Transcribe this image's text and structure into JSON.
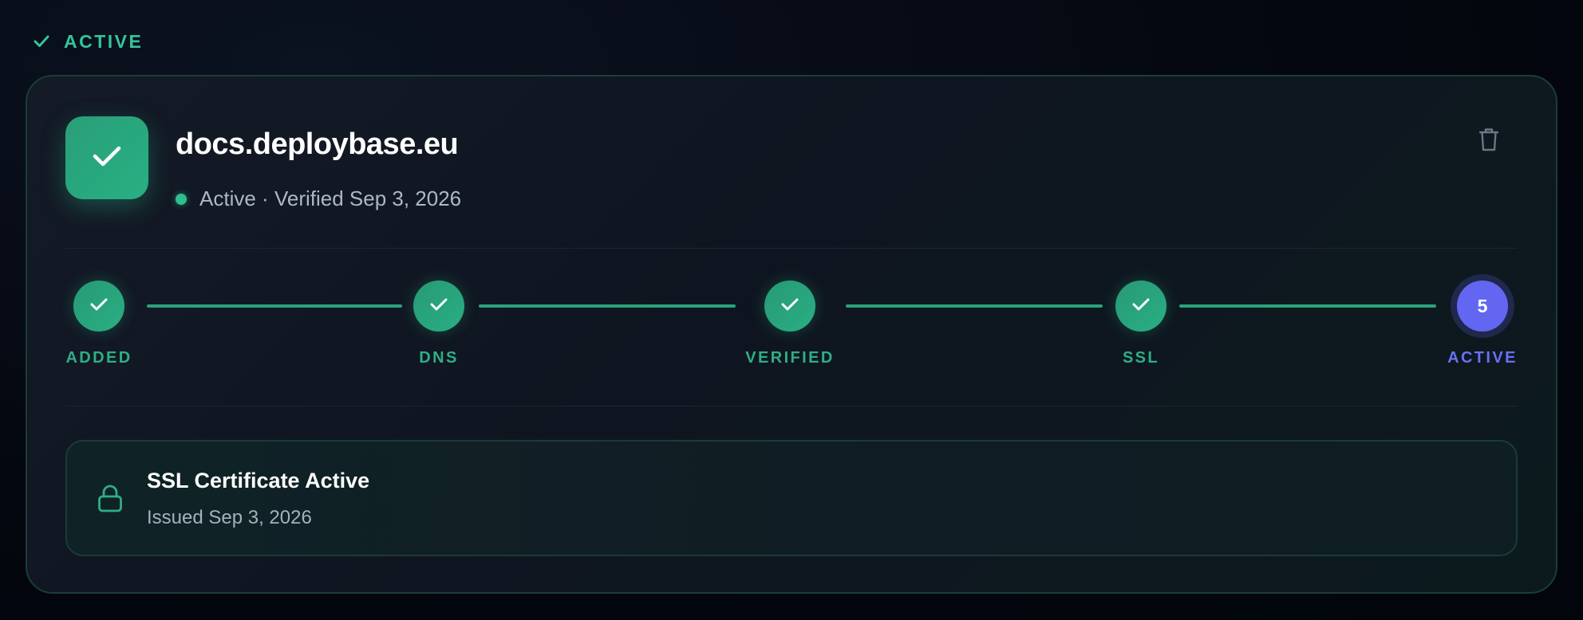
{
  "top_status": {
    "label": "ACTIVE"
  },
  "domain": {
    "name": "docs.deploybase.eu",
    "status": "Active",
    "separator": "·",
    "verified": "Verified Sep 3, 2026"
  },
  "steps": [
    {
      "label": "ADDED",
      "state": "complete"
    },
    {
      "label": "DNS",
      "state": "complete"
    },
    {
      "label": "VERIFIED",
      "state": "complete"
    },
    {
      "label": "SSL",
      "state": "complete"
    },
    {
      "label": "ACTIVE",
      "state": "current",
      "number": "5"
    }
  ],
  "ssl": {
    "title": "SSL Certificate Active",
    "issued": "Issued Sep 3, 2026"
  },
  "colors": {
    "accent_green": "#2aae83",
    "current_step": "#6366f1",
    "background": "#030712"
  },
  "icons": {
    "status": "check-icon",
    "badge": "check-icon",
    "delete": "trash-icon",
    "ssl": "lock-icon"
  }
}
